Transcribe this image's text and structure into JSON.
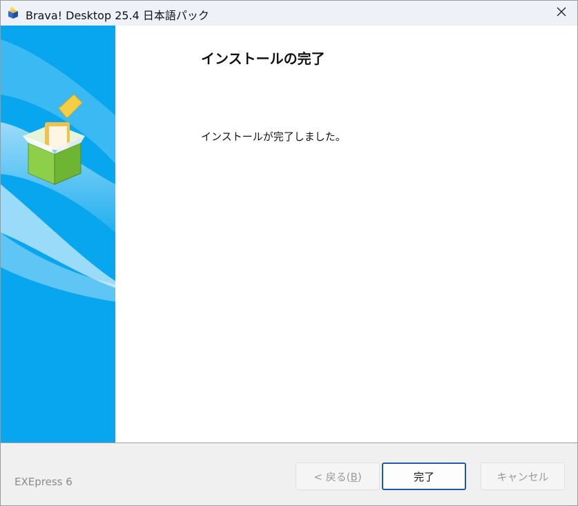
{
  "window": {
    "title": "Brava! Desktop 25.4 日本語パック"
  },
  "icons": {
    "app": "installer-box-icon",
    "close": "close-icon",
    "sidebar_art": "package-box-icon"
  },
  "content": {
    "heading": "インストールの完了",
    "message": "インストールが完了しました。"
  },
  "footer": {
    "brand": "EXEpress 6",
    "back_prefix": "< 戻る(",
    "back_mnemonic": "B",
    "back_suffix": ")",
    "finish_label": "完了",
    "cancel_label": "キャンセル"
  },
  "colors": {
    "sidebar": "#08a6ee",
    "focus_border": "#1a5aa8",
    "disabled_text": "#9a9a9a"
  }
}
